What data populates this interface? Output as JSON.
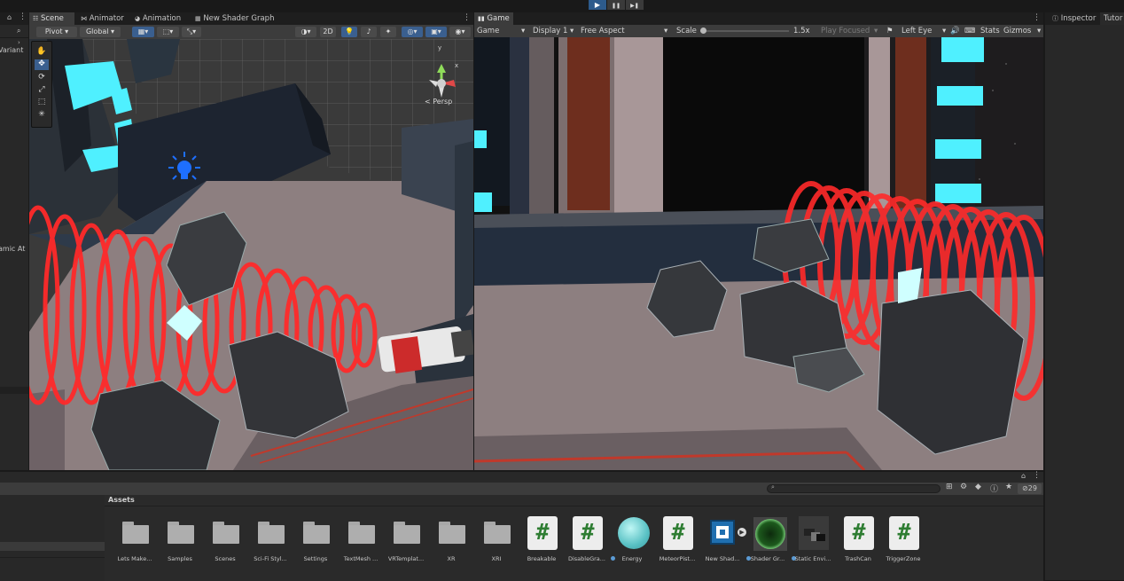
{
  "colors": {
    "accent": "#2d5b8c",
    "cyan": "#4ff0ff",
    "red_coil": "#ff2a2a",
    "panel": "#282828",
    "toolbar": "#3c3c3c"
  },
  "top_controls": {
    "play_icon": "▶",
    "pause_icon": "❚❚",
    "step_icon": "▶❚"
  },
  "left_panel": {
    "variant_label": "Variant",
    "dynamic_label": "amic At"
  },
  "scene_tabs": [
    {
      "label": "Scene",
      "icon": "scene-icon"
    },
    {
      "label": "Animator",
      "icon": "animator-icon"
    },
    {
      "label": "Animation",
      "icon": "animation-icon"
    },
    {
      "label": "New Shader Graph",
      "icon": "shadergraph-icon"
    }
  ],
  "scene_toolbar": {
    "pivot": "Pivot",
    "global": "Global",
    "two_d": "2D",
    "persp_label": "< Persp",
    "gizmo_axis_y": "y",
    "gizmo_axis_x": "x"
  },
  "scene_tools": [
    "hand-tool",
    "move-tool",
    "rotate-tool",
    "scale-tool",
    "rect-tool",
    "transform-tool"
  ],
  "game": {
    "tab_label": "Game",
    "mode": "Game",
    "display": "Display 1",
    "aspect": "Free Aspect",
    "scale_label": "Scale",
    "scale_value": "1.5x",
    "play_focused": "Play Focused",
    "eye": "Left Eye",
    "stats": "Stats",
    "gizmos": "Gizmos"
  },
  "right_panel": {
    "inspector": "Inspector",
    "tutorials": "Tutor"
  },
  "project": {
    "search_placeholder": "",
    "hidden_count": "29",
    "assets_header": "Assets",
    "items": [
      {
        "name": "Lets Make...",
        "kind": "folder"
      },
      {
        "name": "Samples",
        "kind": "folder"
      },
      {
        "name": "Scenes",
        "kind": "folder"
      },
      {
        "name": "Sci-Fi Styl...",
        "kind": "folder"
      },
      {
        "name": "Settings",
        "kind": "folder"
      },
      {
        "name": "TextMesh ...",
        "kind": "folder"
      },
      {
        "name": "VRTemplat...",
        "kind": "folder"
      },
      {
        "name": "XR",
        "kind": "folder"
      },
      {
        "name": "XRI",
        "kind": "folder"
      },
      {
        "name": "Breakable",
        "kind": "script"
      },
      {
        "name": "DisableGra...",
        "kind": "script"
      },
      {
        "name": "Energy",
        "kind": "material"
      },
      {
        "name": "MeteorPist...",
        "kind": "script"
      },
      {
        "name": "New Shad...",
        "kind": "shadergraph"
      },
      {
        "name": "Shader Gr...",
        "kind": "material"
      },
      {
        "name": "Static Envi...",
        "kind": "prefab"
      },
      {
        "name": "TrashCan",
        "kind": "script"
      },
      {
        "name": "TriggerZone",
        "kind": "script"
      }
    ]
  }
}
